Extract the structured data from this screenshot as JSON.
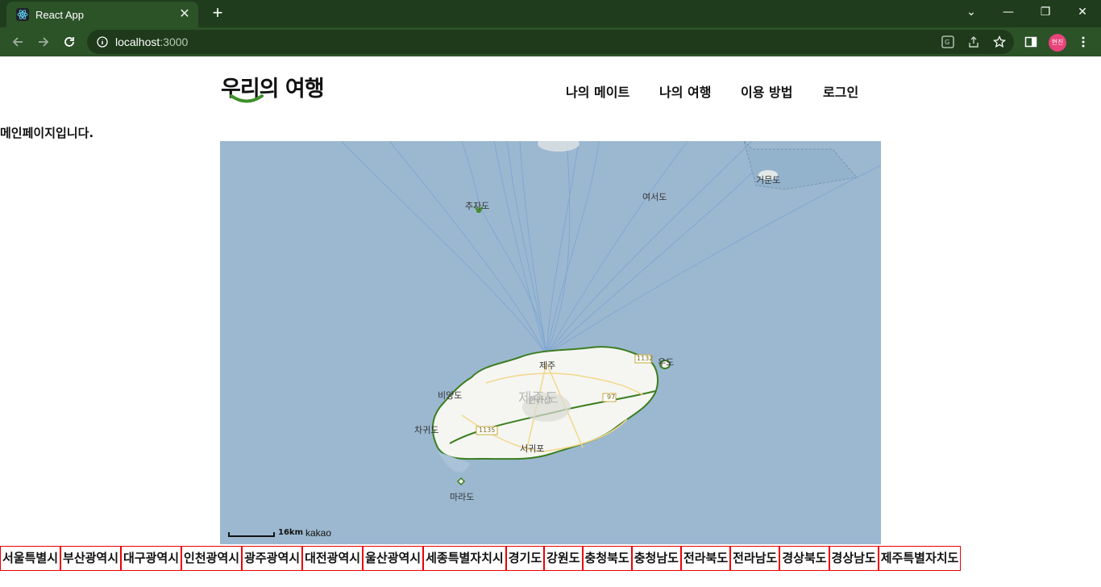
{
  "browser": {
    "tab_title": "React App",
    "url_host": "localhost",
    "url_port": ":3000",
    "profile_label": "현진"
  },
  "header": {
    "logo_text": "우리의 여행",
    "nav": [
      "나의 메이트",
      "나의 여행",
      "이용 방법",
      "로그인"
    ]
  },
  "main": {
    "message": "메인페이지입니다."
  },
  "map": {
    "labels": {
      "chujado": "추자도",
      "yeoseodo": "여서도",
      "geomundo": "거문도",
      "jeju_city": "제주",
      "jejudo": "제주도",
      "hallasan": "한라산",
      "biyangdo": "비양도",
      "chagwido": "차귀도",
      "seogwipo": "서귀포",
      "marado": "마라도",
      "udo": "우도",
      "road_97": "97",
      "road_1135": "1135",
      "road_1132": "1132"
    },
    "scale": "16km",
    "provider": "kakao"
  },
  "regions": [
    "서울특별시",
    "부산광역시",
    "대구광역시",
    "인천광역시",
    "광주광역시",
    "대전광역시",
    "울산광역시",
    "세종특별자치시",
    "경기도",
    "강원도",
    "충청북도",
    "충청남도",
    "전라북도",
    "전라남도",
    "경상북도",
    "경상남도",
    "제주특별자치도"
  ]
}
